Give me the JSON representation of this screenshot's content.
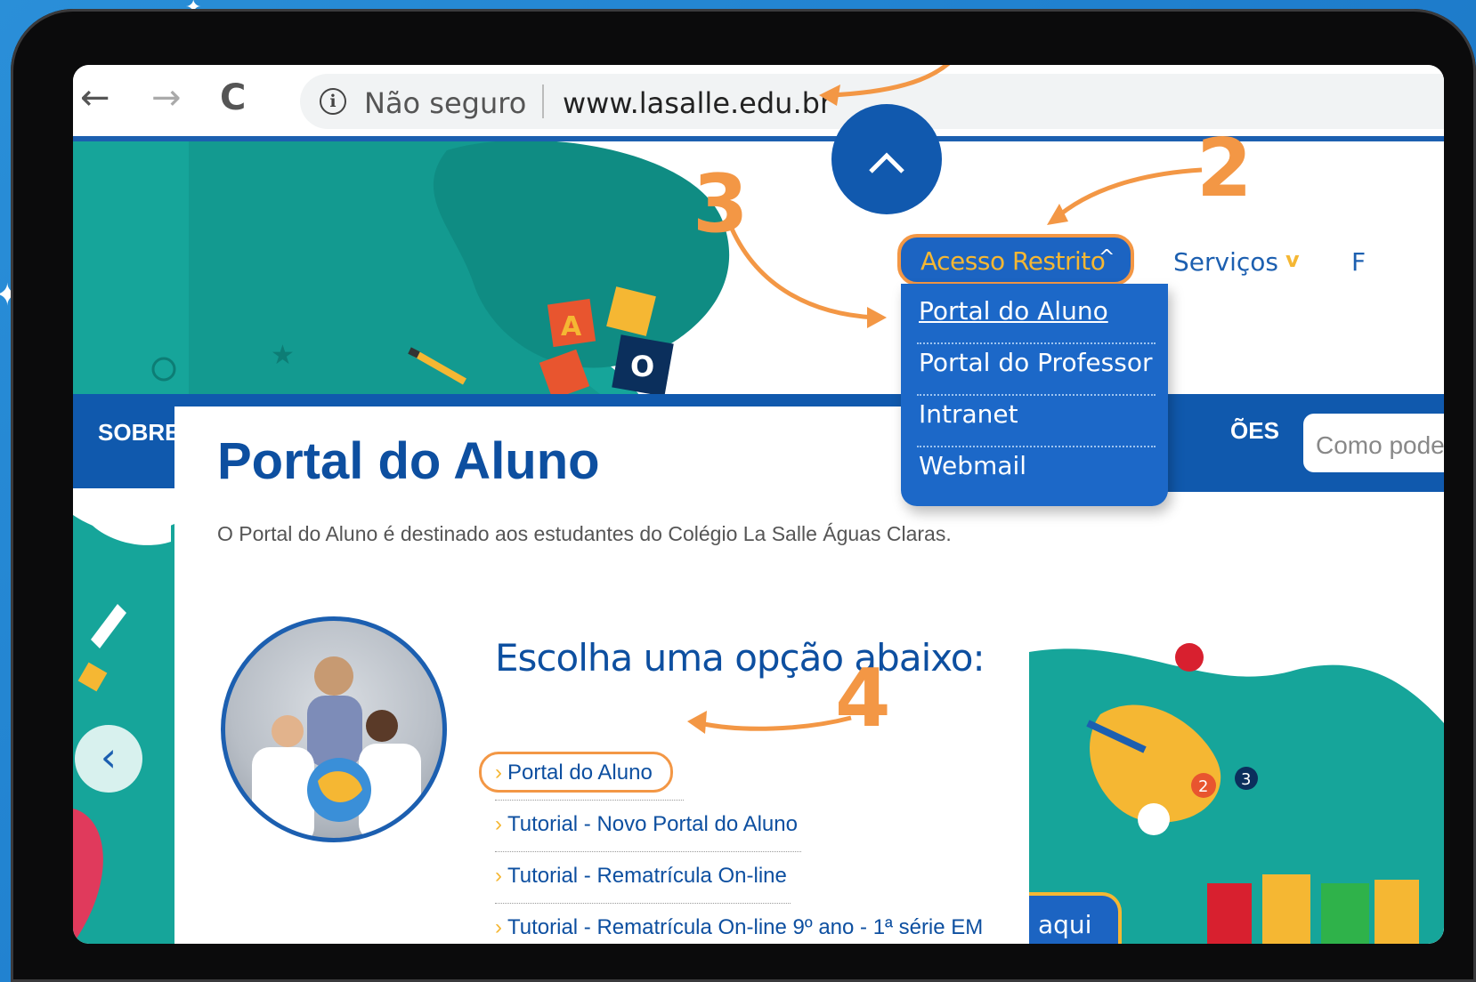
{
  "browser": {
    "security_label": "Não seguro",
    "url": "www.lasalle.edu.br",
    "back_icon": "←",
    "forward_icon": "→",
    "reload_icon": "C"
  },
  "header": {
    "menu_button_label": "Acesso Restrito",
    "menu_button_chevron": "^",
    "nav_servicos": "Serviços",
    "nav_servicos_chevron": "v",
    "nav_partial": "F",
    "nav_sobre": "SOBRE",
    "nav_oes": "ÕES",
    "search_placeholder": "Como pode"
  },
  "dropdown": {
    "items": [
      {
        "label": "Portal do Aluno"
      },
      {
        "label": "Portal do Professor"
      },
      {
        "label": "Intranet"
      },
      {
        "label": "Webmail"
      }
    ]
  },
  "content": {
    "title": "Portal do Aluno",
    "description": "O Portal do Aluno é destinado aos estudantes do Colégio La Salle Águas Claras.",
    "choose_title": "Escolha uma opção abaixo:",
    "options": [
      {
        "label": "Portal do Aluno"
      },
      {
        "label": "Tutorial - Novo Portal do Aluno"
      },
      {
        "label": "Tutorial - Rematrícula On-line"
      },
      {
        "label": "Tutorial - Rematrícula On-line 9º ano - 1ª série EM"
      }
    ]
  },
  "aqui_label": "aqui",
  "annotations": {
    "step2": "2",
    "step3": "3",
    "step4": "4",
    "color": "#f39745"
  },
  "colors": {
    "brand_blue": "#1059ad",
    "accent_orange": "#f39745",
    "accent_yellow": "#f5b733",
    "teal": "#16a59a"
  }
}
